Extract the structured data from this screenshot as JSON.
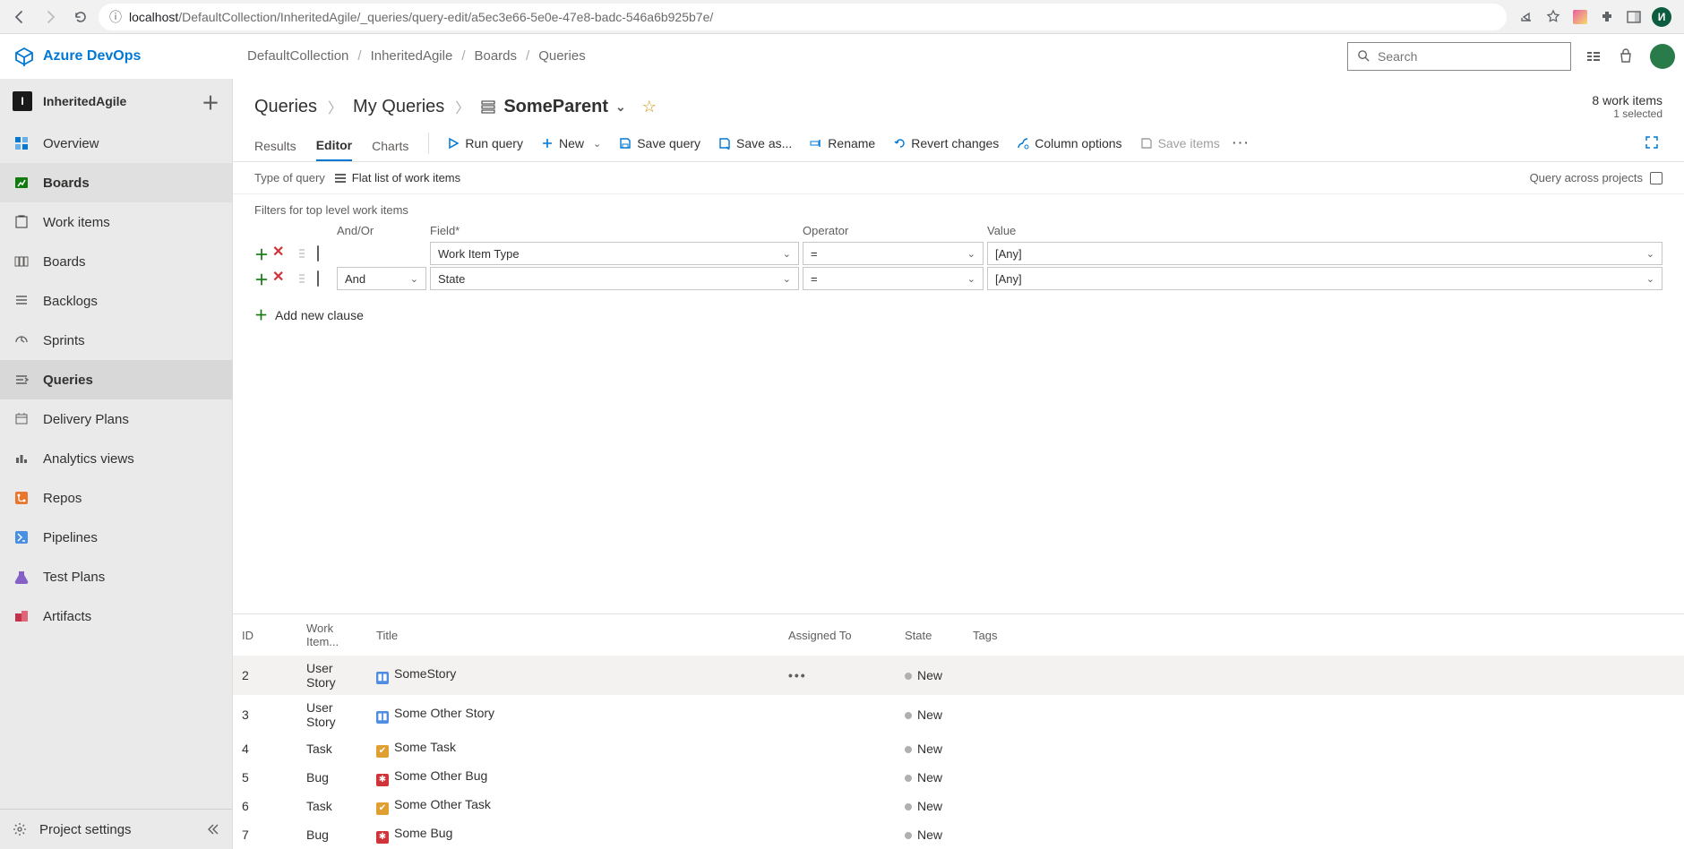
{
  "browser": {
    "url_info_icon": "ⓘ",
    "url_host": "localhost",
    "url_path": "/DefaultCollection/InheritedAgile/_queries/query-edit/a5ec3e66-5e0e-47e8-badc-546a6b925b7e/",
    "avatar_initial": "И"
  },
  "header": {
    "brand": "Azure DevOps",
    "breadcrumbs": [
      "DefaultCollection",
      "InheritedAgile",
      "Boards",
      "Queries"
    ],
    "search_placeholder": "Search"
  },
  "sidebar": {
    "project_name": "InheritedAgile",
    "project_initial": "I",
    "overview": "Overview",
    "boards": "Boards",
    "boards_children": {
      "work_items": "Work items",
      "boards_sub": "Boards",
      "backlogs": "Backlogs",
      "sprints": "Sprints",
      "queries": "Queries",
      "delivery_plans": "Delivery Plans",
      "analytics": "Analytics views"
    },
    "repos": "Repos",
    "pipelines": "Pipelines",
    "test_plans": "Test Plans",
    "artifacts": "Artifacts",
    "project_settings": "Project settings"
  },
  "page": {
    "bc_queries": "Queries",
    "bc_my_queries": "My Queries",
    "bc_title": "SomeParent",
    "work_items_count": "8 work items",
    "selected": "1 selected"
  },
  "tabs": {
    "results": "Results",
    "editor": "Editor",
    "charts": "Charts"
  },
  "toolbar": {
    "run_query": "Run query",
    "new": "New",
    "save_query": "Save query",
    "save_as": "Save as...",
    "rename": "Rename",
    "revert": "Revert changes",
    "column_options": "Column options",
    "save_items": "Save items"
  },
  "query_type": {
    "label": "Type of query",
    "value": "Flat list of work items",
    "across_projects": "Query across projects"
  },
  "filters": {
    "heading": "Filters for top level work items",
    "columns": {
      "andor": "And/Or",
      "field": "Field*",
      "operator": "Operator",
      "value": "Value"
    },
    "rows": [
      {
        "andor": "",
        "field": "Work Item Type",
        "operator": "=",
        "value": "[Any]"
      },
      {
        "andor": "And",
        "field": "State",
        "operator": "=",
        "value": "[Any]"
      }
    ],
    "add_clause": "Add new clause"
  },
  "results": {
    "columns": {
      "id": "ID",
      "wit": "Work Item...",
      "title": "Title",
      "assigned": "Assigned To",
      "state": "State",
      "tags": "Tags"
    },
    "rows": [
      {
        "id": "2",
        "wit": "User Story",
        "icon": "story",
        "title": "SomeStory",
        "assigned": "",
        "state": "New",
        "selected": true
      },
      {
        "id": "3",
        "wit": "User Story",
        "icon": "story",
        "title": "Some Other Story",
        "assigned": "",
        "state": "New"
      },
      {
        "id": "4",
        "wit": "Task",
        "icon": "task",
        "title": "Some Task",
        "assigned": "",
        "state": "New"
      },
      {
        "id": "5",
        "wit": "Bug",
        "icon": "bug",
        "title": "Some Other Bug",
        "assigned": "",
        "state": "New"
      },
      {
        "id": "6",
        "wit": "Task",
        "icon": "task",
        "title": "Some Other Task",
        "assigned": "",
        "state": "New"
      },
      {
        "id": "7",
        "wit": "Bug",
        "icon": "bug",
        "title": "Some Bug",
        "assigned": "",
        "state": "New"
      }
    ]
  }
}
